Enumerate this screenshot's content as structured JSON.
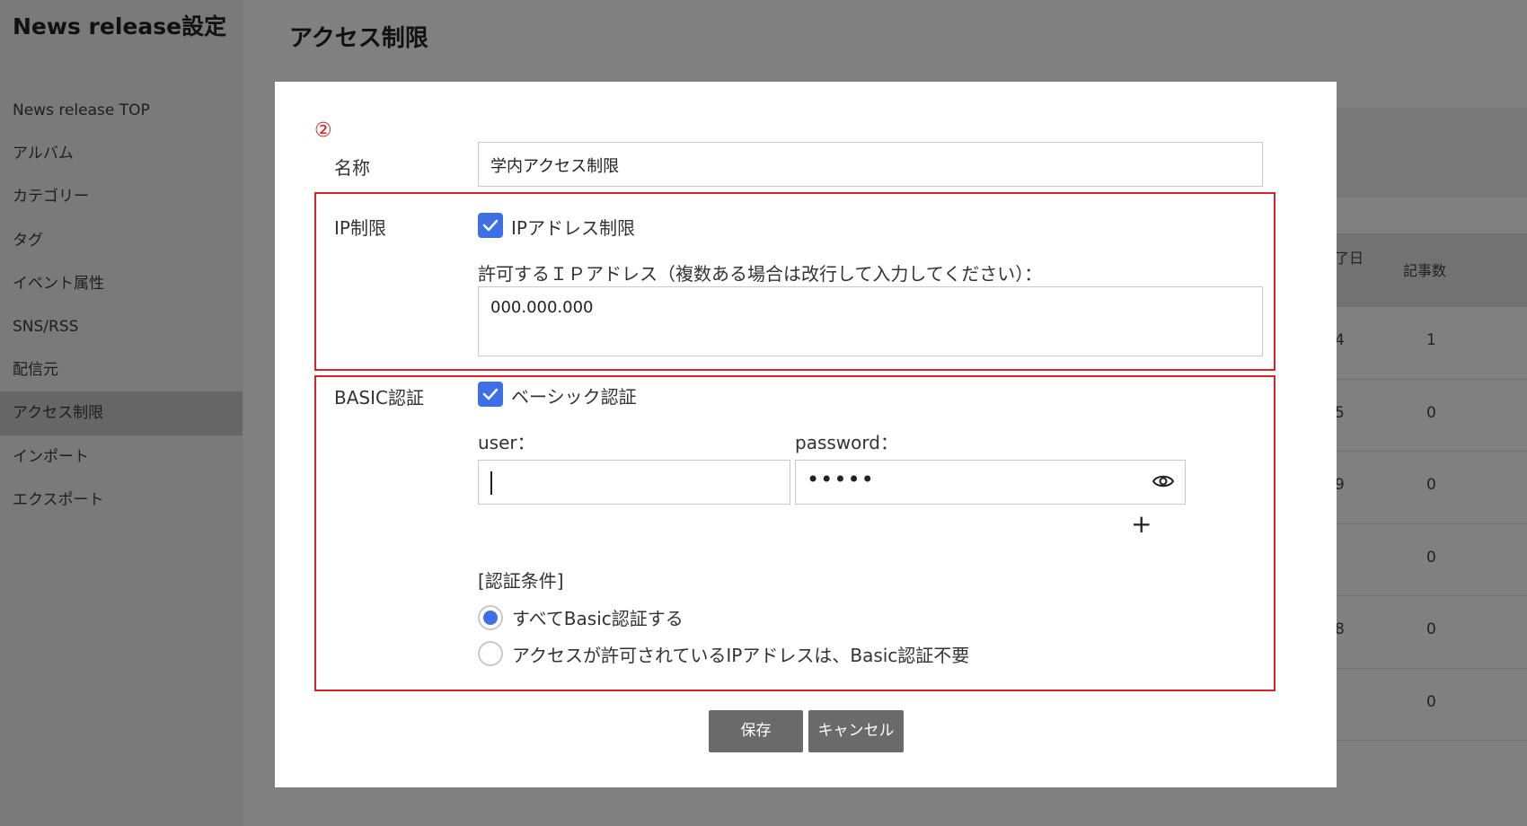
{
  "sidebar": {
    "title": "News release設定",
    "items": [
      {
        "label": "News release TOP"
      },
      {
        "label": "アルバム"
      },
      {
        "label": "カテゴリー"
      },
      {
        "label": "タグ"
      },
      {
        "label": "イベント属性"
      },
      {
        "label": "SNS/RSS"
      },
      {
        "label": "配信元"
      },
      {
        "label": "アクセス制限",
        "active": true
      },
      {
        "label": "インポート"
      },
      {
        "label": "エクスポート"
      }
    ]
  },
  "page": {
    "title": "アクセス制限",
    "table": {
      "headers": [
        "了日",
        "記事数"
      ],
      "rows": [
        {
          "date": "4",
          "count": "1"
        },
        {
          "date": "5",
          "count": "0"
        },
        {
          "date": "9",
          "count": "0"
        },
        {
          "date": "",
          "count": "0"
        },
        {
          "date": "8",
          "count": "0"
        },
        {
          "date": "",
          "count": "0"
        }
      ]
    }
  },
  "modal": {
    "step_marker": "②",
    "name": {
      "label": "名称",
      "value": "学内アクセス制限"
    },
    "ip": {
      "label": "IP制限",
      "checkbox_label": "IPアドレス制限",
      "checked": true,
      "allowed_label": "許可するＩＰアドレス（複数ある場合は改行して入力してください）：",
      "allowed_value": "000.000.000"
    },
    "basic": {
      "label": "BASIC認証",
      "checkbox_label": "ベーシック認証",
      "checked": true,
      "user_label": "user：",
      "user_value": "",
      "password_label": "password：",
      "password_mask": "•••••",
      "add_symbol": "+",
      "condition_label": "[認証条件]",
      "options": [
        {
          "label": "すべてBasic認証する",
          "selected": true
        },
        {
          "label": "アクセスが許可されているIPアドレスは、Basic認証不要",
          "selected": false
        }
      ]
    },
    "buttons": {
      "save": "保存",
      "cancel": "キャンセル"
    }
  },
  "colors": {
    "accent": "#3d6fe6",
    "highlight_border": "#d9232b",
    "overlay": "#808080",
    "button": "#6a6a6a"
  },
  "icons": [
    "check-icon",
    "eye-icon",
    "plus-icon"
  ]
}
